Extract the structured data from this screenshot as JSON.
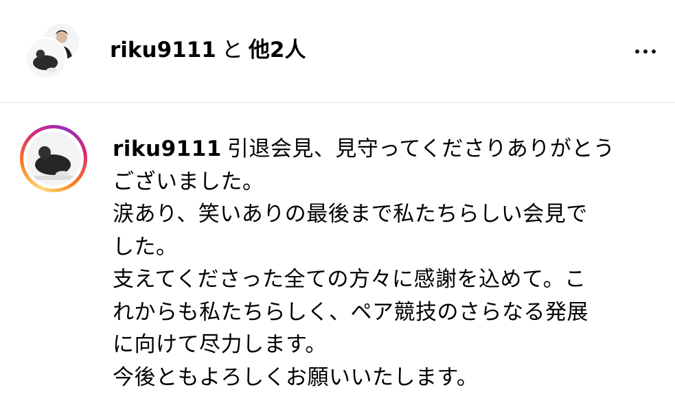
{
  "header": {
    "username": "riku9111",
    "connector": "と",
    "others": "他2人",
    "more_icon": "more-horizontal-icon"
  },
  "post": {
    "username": "riku9111",
    "caption_lines": [
      "引退会見、見守ってくださりありがとう",
      "ございました。",
      "涙あり、笑いありの最後まで私たちらしい会見で",
      "した。",
      "支えてくださった全ての方々に感謝を込めて。こ",
      "れからも私たちらしく、ペア競技のさらなる発展",
      "に向けて尽力します。",
      "今後ともよろしくお願いいたします。"
    ]
  },
  "colors": {
    "border": "#e6e6e6",
    "text": "#000000",
    "story_ring": [
      "#feda75",
      "#fa7e1e",
      "#d62976",
      "#962fbf"
    ]
  }
}
